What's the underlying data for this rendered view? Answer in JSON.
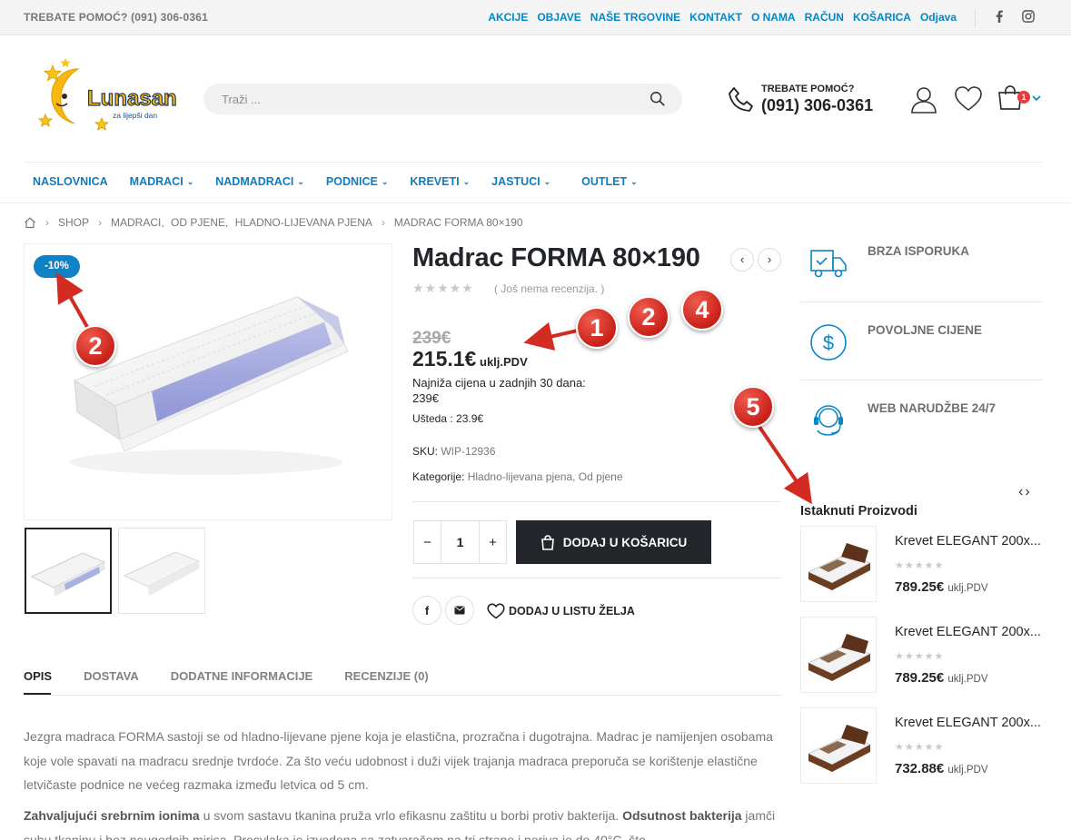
{
  "topbar": {
    "help": "TREBATE POMOĆ? (091) 306-0361",
    "links": [
      "AKCIJE",
      "OBJAVE",
      "NAŠE TRGOVINE",
      "KONTAKT",
      "O NAMA",
      "RAČUN",
      "KOŠARICA",
      "Odjava"
    ],
    "social": [
      "facebook-icon",
      "instagram-icon"
    ]
  },
  "header": {
    "logo_text": "Lunasan",
    "logo_tagline": "za lijepši dan",
    "search_placeholder": "Traži ...",
    "phone_label": "TREBATE POMOĆ?",
    "phone_number": "(091) 306-0361",
    "cart_count": "1"
  },
  "nav": [
    "NASLOVNICA",
    "MADRACI",
    "NADMADRACI",
    "PODNICE",
    "KREVETI",
    "JASTUCI",
    "OUTLET"
  ],
  "breadcrumb": [
    "SHOP",
    "MADRACI,",
    "OD PJENE,",
    "HLADNO-LIJEVANA PJENA",
    "MADRAC FORMA 80×190"
  ],
  "product": {
    "discount_badge": "-10%",
    "title": "Madrac FORMA 80×190",
    "reviews": "( Još nema recenzija. )",
    "old_price": "239€",
    "price": "215.1€",
    "price_suffix": "uklj.PDV",
    "lowest_label": "Najniža cijena u zadnjih 30 dana:",
    "lowest_value": "239€",
    "savings": "Ušteda : 23.9€",
    "sku_label": "SKU:",
    "sku": "WIP-12936",
    "categories_label": "Kategorije:",
    "categories": "Hladno-lijevana pjena, Od pjene",
    "quantity": "1",
    "add_to_cart": "DODAJ U KOŠARICU",
    "wishlist": "DODAJ U LISTU ŽELJA"
  },
  "tabs": [
    "OPIS",
    "DOSTAVA",
    "DODATNE INFORMACIJE",
    "RECENZIJE (0)"
  ],
  "description": {
    "p1": "Jezgra madraca FORMA sastoji se od hladno-lijevane pjene koja je elastična, prozračna i dugotrajna.  Madrac je namijenjen osobama koje vole spavati na madracu srednje tvrdoće. Za što veću udobnost i duži vijek trajanja madraca preporuča se korištenje elastične letvičaste podnice ne većeg razmaka između letvica od 5 cm.",
    "p2_b1": "Zahvaljujući srebrnim ionima",
    "p2_t1": " u svom sastavu tkanina pruža vrlo efikasnu zaštitu u borbi protiv bakterija. ",
    "p2_b2": "Odsutnost bakterija",
    "p2_t2": " jamči suhu tkaninu i bez neugodnih mirisa. Presvlaka je izvedena sa zatvaračem na tri strane i periva je do 40°C, što"
  },
  "sidebar": {
    "services": [
      {
        "label": "BRZA ISPORUKA",
        "icon": "truck-icon"
      },
      {
        "label": "POVOLJNE CIJENE",
        "icon": "dollar-icon"
      },
      {
        "label": "WEB NARUDŽBE 24/7",
        "icon": "support-icon"
      }
    ],
    "featured_title": "Istaknuti Proizvodi",
    "products": [
      {
        "name": "Krevet ELEGANT 200x...",
        "price": "789.25€",
        "suffix": "uklj.PDV"
      },
      {
        "name": "Krevet ELEGANT 200x...",
        "price": "789.25€",
        "suffix": "uklj.PDV"
      },
      {
        "name": "Krevet ELEGANT 200x...",
        "price": "732.88€",
        "suffix": "uklj.PDV"
      }
    ]
  },
  "annotations": [
    "2",
    "1",
    "2",
    "4",
    "5"
  ],
  "colors": {
    "accent": "#0088cc",
    "dark": "#222529",
    "annotation": "#d32b22",
    "badge": "#0f81c5"
  }
}
